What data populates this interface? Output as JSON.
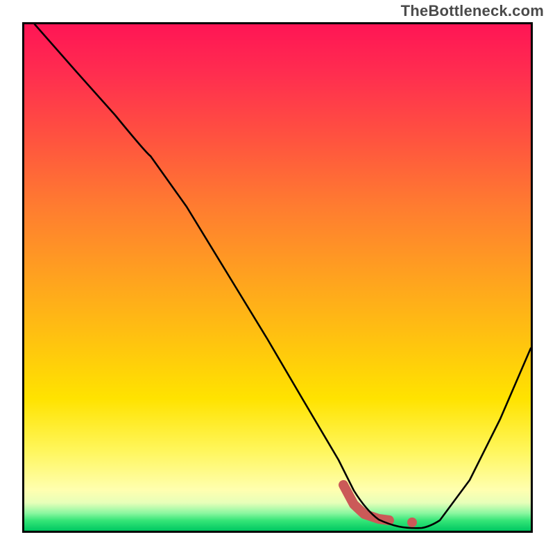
{
  "attribution": "TheBottleneck.com",
  "colors": {
    "gradient_top": "#ff1555",
    "gradient_mid": "#ffd400",
    "gradient_bottom": "#00c862",
    "curve": "#000000",
    "accent": "#cb5a58",
    "frame": "#000000"
  },
  "chart_data": {
    "type": "line",
    "title": "",
    "xlabel": "",
    "ylabel": "",
    "xlim": [
      0,
      100
    ],
    "ylim": [
      0,
      100
    ],
    "grid": false,
    "legend": false,
    "notes": "No axis ticks or numeric labels are shown; values below are estimated from pixel positions on a 0–100 normalized grid. y=0 corresponds to the green band at the bottom; y=100 to the magenta top.",
    "series": [
      {
        "name": "bottleneck-curve",
        "x": [
          2,
          10,
          18,
          25,
          32,
          40,
          48,
          55,
          62,
          65,
          67.5,
          70,
          72,
          74,
          76,
          78.5,
          82,
          88,
          94,
          100
        ],
        "y": [
          100,
          91,
          82,
          74,
          64,
          51,
          38,
          26,
          14,
          8,
          4,
          2,
          1.2,
          0.8,
          0.6,
          0.5,
          2,
          10,
          22,
          36
        ]
      }
    ],
    "accent_segment": {
      "name": "highlighted-near-minimum",
      "x": [
        63,
        65,
        67,
        70,
        72
      ],
      "y": [
        9,
        5,
        3.2,
        2.2,
        2
      ],
      "dot_after_gap": {
        "x": 76.5,
        "y": 1.6
      }
    },
    "minimum_estimate": {
      "x": 78.5,
      "y": 0.5
    }
  }
}
